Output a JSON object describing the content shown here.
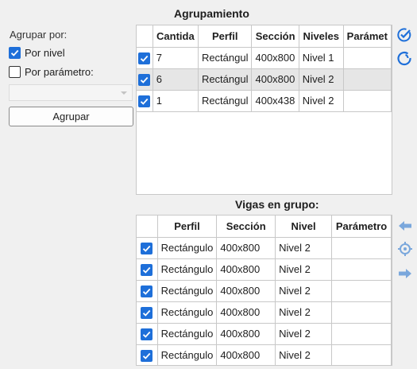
{
  "left_panel": {
    "group_by_label": "Agrupar por:",
    "option_level": {
      "label": "Por nivel",
      "checked": true
    },
    "option_param": {
      "label": "Por parámetro:",
      "checked": false
    },
    "param_select_value": "",
    "group_button": "Agrupar"
  },
  "grouping": {
    "title": "Agrupamiento",
    "columns": [
      "Cantida",
      "Perfil",
      "Sección",
      "Niveles",
      "Parámet"
    ],
    "rows": [
      {
        "checked": true,
        "cells": [
          "7",
          "Rectángul",
          "400x800",
          "Nivel 1",
          ""
        ]
      },
      {
        "checked": true,
        "cells": [
          "6",
          "Rectángul",
          "400x800",
          "Nivel 2",
          ""
        ],
        "selected": true
      },
      {
        "checked": true,
        "cells": [
          "1",
          "Rectángul",
          "400x438",
          "Nivel 2",
          ""
        ]
      }
    ]
  },
  "beams": {
    "title": "Vigas en grupo:",
    "columns": [
      "Perfil",
      "Sección",
      "Nivel",
      "Parámetro"
    ],
    "rows": [
      {
        "checked": true,
        "cells": [
          "Rectángulo",
          "400x800",
          "Nivel 2",
          ""
        ]
      },
      {
        "checked": true,
        "cells": [
          "Rectángulo",
          "400x800",
          "Nivel 2",
          ""
        ]
      },
      {
        "checked": true,
        "cells": [
          "Rectángulo",
          "400x800",
          "Nivel 2",
          ""
        ]
      },
      {
        "checked": true,
        "cells": [
          "Rectángulo",
          "400x800",
          "Nivel 2",
          ""
        ]
      },
      {
        "checked": true,
        "cells": [
          "Rectángulo",
          "400x800",
          "Nivel 2",
          ""
        ]
      },
      {
        "checked": true,
        "cells": [
          "Rectángulo",
          "400x800",
          "Nivel 2",
          ""
        ]
      }
    ]
  },
  "icons": {
    "top": [
      "check-all-icon",
      "circle-refresh-icon"
    ],
    "side": [
      "arrow-left-icon",
      "target-icon",
      "arrow-right-icon"
    ]
  },
  "colors": {
    "accent": "#1e6fd9",
    "icon_blue": "#7aa7dc",
    "selected_row": "#e6e6e6"
  }
}
